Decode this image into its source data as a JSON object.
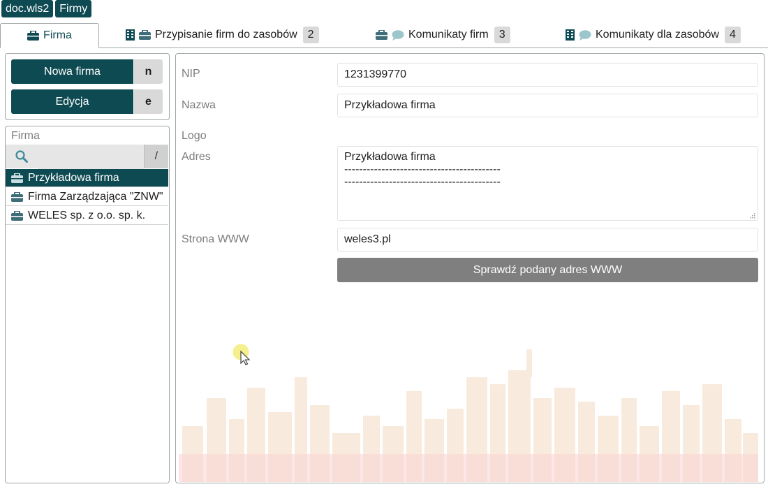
{
  "breadcrumbs": [
    "doc.wls2",
    "Firmy"
  ],
  "tabs": [
    {
      "label": "Firma",
      "badge": ""
    },
    {
      "label": "Przypisanie firm do zasobów",
      "badge": "2"
    },
    {
      "label": "Komunikaty firm",
      "badge": "3"
    },
    {
      "label": "Komunikaty dla zasobów",
      "badge": "4"
    }
  ],
  "actions": {
    "new_label": "Nowa firma",
    "new_key": "n",
    "edit_label": "Edycja",
    "edit_key": "e"
  },
  "list": {
    "title": "Firma",
    "search_value": "",
    "search_shortcut": "/",
    "items": [
      "Przykładowa firma",
      "Firma Zarządzająca \"ZNW\"",
      "WELES sp. z o.o. sp. k."
    ],
    "selected_index": 0
  },
  "form": {
    "nip_label": "NIP",
    "nip_value": "1231399770",
    "name_label": "Nazwa",
    "name_value": "Przykładowa firma",
    "logo_label": "Logo",
    "address_label": "Adres",
    "address_value": "Przykładowa firma\n------------------------------------------\n------------------------------------------",
    "www_label": "Strona WWW",
    "www_value": "weles3.pl",
    "check_button": "Sprawdź podany adres WWW"
  },
  "colors": {
    "accent": "#0e4a52",
    "button_gray": "#7f7f7f",
    "badge_gray": "#d9d9d9"
  },
  "icons": [
    "briefcase-icon",
    "building-icon",
    "speech-bubble-icon",
    "search-icon",
    "resize-grip-icon",
    "mouse-cursor-icon"
  ]
}
